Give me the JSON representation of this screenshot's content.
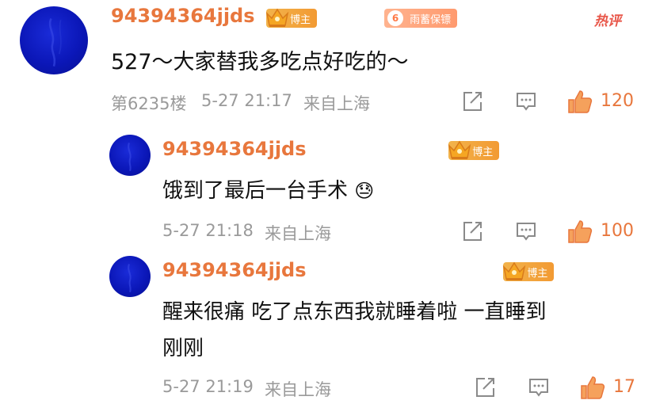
{
  "comment": {
    "username": "94394364jjds",
    "author_badge": "博主",
    "fan_badge": {
      "level": "6",
      "label": "雨蓄保镖"
    },
    "hot_label": "热评",
    "content": "527～大家替我多吃点好吃的～",
    "floor": "第6235楼",
    "time": "5-27 21:17",
    "location": "来自上海",
    "likes": "120"
  },
  "replies": [
    {
      "username": "94394364jjds",
      "author_badge": "博主",
      "content": "饿到了最后一台手术",
      "emoji": "😓",
      "time": "5-27 21:18",
      "location": "来自上海",
      "likes": "100"
    },
    {
      "username": "94394364jjds",
      "author_badge": "博主",
      "content_line1": "醒来很痛 吃了点东西我就睡着啦 一直睡到",
      "content_line2": "刚刚",
      "time": "5-27 21:19",
      "location": "来自上海",
      "likes": "17"
    }
  ],
  "icons": {
    "share": "share-icon",
    "comment": "comment-icon",
    "like": "thumbs-up-icon",
    "crown": "crown-icon"
  },
  "colors": {
    "username": "#e8773d",
    "hot": "#e8574a",
    "meta": "#9a9a9a",
    "avatar": "#0b17b8"
  }
}
